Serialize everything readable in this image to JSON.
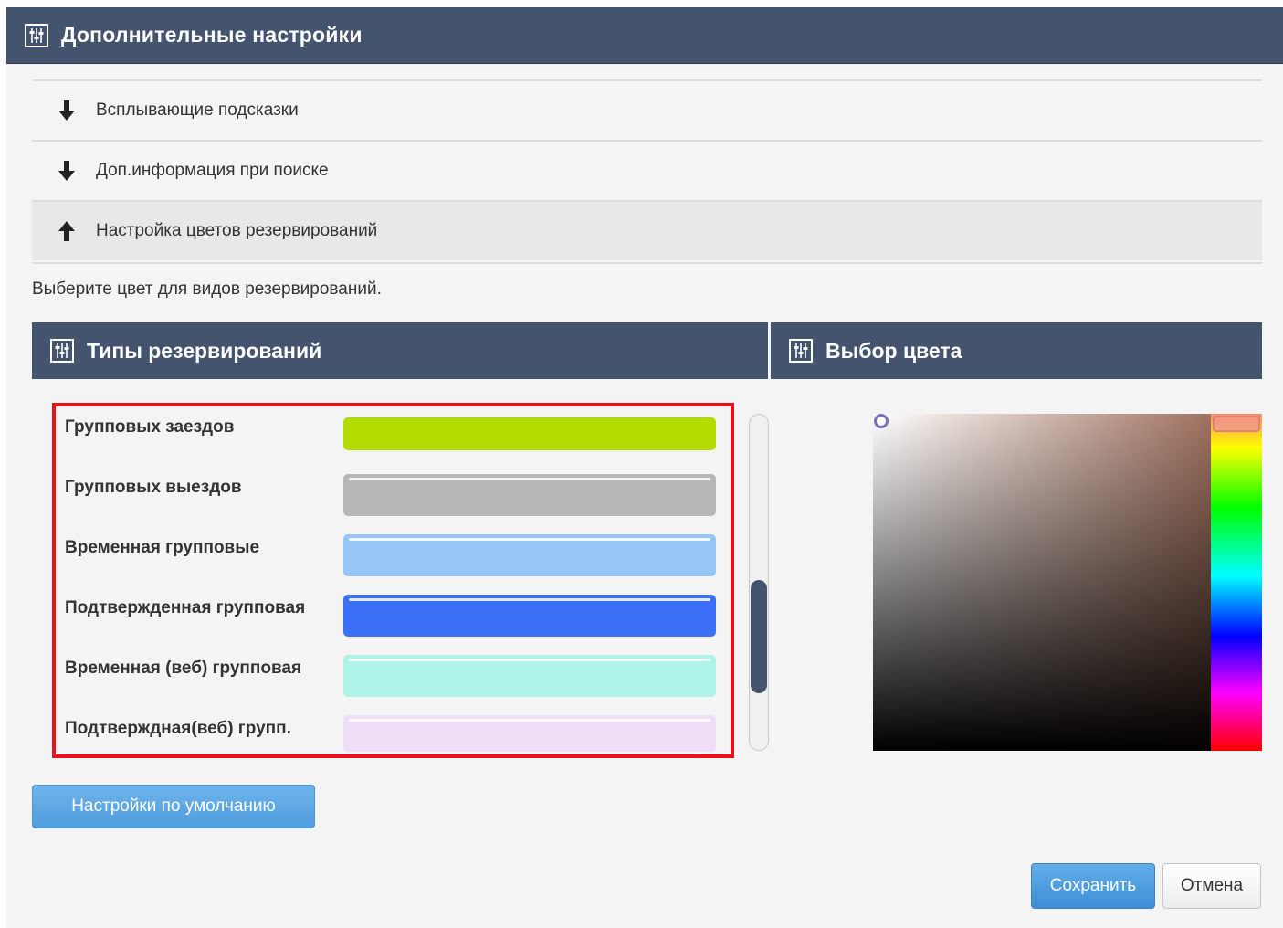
{
  "dialog": {
    "title": "Дополнительные настройки",
    "title_icon": "sliders-icon"
  },
  "accordion": {
    "items": [
      {
        "label": "Всплывающие подсказки",
        "icon": "arrow-down-icon",
        "expanded": false
      },
      {
        "label": "Доп.информация при поиске",
        "icon": "arrow-down-icon",
        "expanded": false
      },
      {
        "label": "Настройка цветов резервирований",
        "icon": "arrow-up-icon",
        "expanded": true
      }
    ]
  },
  "hint": "Выберите цвет для видов резервирований.",
  "types_panel": {
    "title": "Типы резервирований",
    "icon": "sliders-icon",
    "types": [
      {
        "label": "Групповых заездов",
        "color": "#b3dd00"
      },
      {
        "label": "Групповых выездов",
        "color": "#b7b7b7"
      },
      {
        "label": "Временная групповые",
        "color": "#97c6f7"
      },
      {
        "label": "Подтвержденная групповая",
        "color": "#3b6ff8"
      },
      {
        "label": "Временная (веб) групповая",
        "color": "#aef3e8"
      },
      {
        "label": "Подтверждная(веб) групп.",
        "color": "#f0ddf8"
      }
    ]
  },
  "color_panel": {
    "title": "Выбор цвета",
    "icon": "sliders-icon"
  },
  "buttons": {
    "default_label": "Настройки по умолчанию",
    "save_label": "Сохранить",
    "cancel_label": "Отмена"
  },
  "colors": {
    "header_bg": "#44546f",
    "highlight_border": "#e8121d",
    "primary_button": "#4f9ddf"
  }
}
